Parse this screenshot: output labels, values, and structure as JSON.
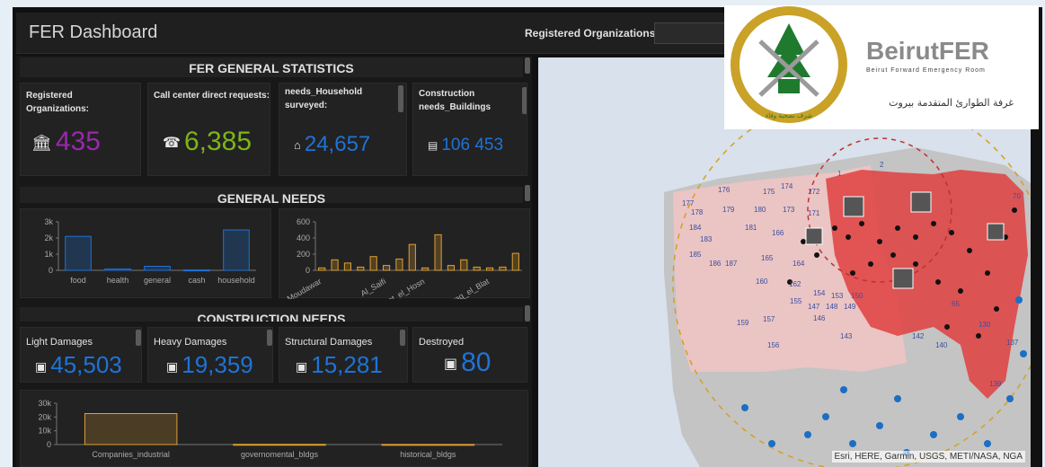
{
  "header": {
    "title": "FER Dashboard",
    "registered_label": "Registered Organizations:"
  },
  "sections": {
    "general_statistics": "FER GENERAL STATISTICS",
    "general_needs": "GENERAL NEEDS",
    "construction_needs": "CONSTRUCTION NEEDS"
  },
  "stats": [
    {
      "label": "Registered Organizations:",
      "value": "435",
      "icon": "institution-icon",
      "color": "#9b27b0"
    },
    {
      "label": "Call center direct requests:",
      "value": "6,385",
      "icon": "phone-icon",
      "color": "#7cb518"
    },
    {
      "label": "needs_Household surveyed:",
      "value": "24,657",
      "icon": "home-icon",
      "color": "#1e73d8"
    },
    {
      "label": "Construction needs_Buildings",
      "value": "106 453",
      "icon": "building-icon",
      "color": "#1e73d8"
    }
  ],
  "construction": [
    {
      "label": "Light Damages",
      "value": "45,503",
      "icon": "bookmark-icon",
      "color": "#1e73d8"
    },
    {
      "label": "Heavy Damages",
      "value": "19,359",
      "icon": "bookmark-icon",
      "color": "#1e73d8"
    },
    {
      "label": "Structural Damages",
      "value": "15,281",
      "icon": "bookmark-icon",
      "color": "#1e73d8"
    },
    {
      "label": "Destroyed",
      "value": "80",
      "icon": "bookmark-icon",
      "color": "#1e73d8"
    }
  ],
  "chart_data": [
    {
      "type": "bar",
      "categories": [
        "food",
        "health",
        "general",
        "cash",
        "household"
      ],
      "values": [
        2100,
        80,
        250,
        20,
        2500
      ],
      "yticks": [
        "3k",
        "2k",
        "1k",
        "0"
      ],
      "ylim": [
        0,
        3000
      ],
      "color": "#1e73d8"
    },
    {
      "type": "bar",
      "categories": [
        "_Moudawar",
        "",
        "",
        "",
        "",
        "Al_Saifi",
        "",
        "",
        "Minet_el_Hosn",
        "",
        "",
        "",
        "",
        "Zoqaq_el_Blat",
        "",
        ""
      ],
      "values": [
        30,
        130,
        90,
        40,
        170,
        60,
        140,
        320,
        30,
        440,
        60,
        130,
        40,
        30,
        40,
        210
      ],
      "yticks": [
        "600",
        "400",
        "200",
        "0"
      ],
      "ylim": [
        0,
        600
      ],
      "color": "#e0a030"
    },
    {
      "type": "bar",
      "categories": [
        "Companies_industrial",
        "governomental_bldgs",
        "historical_bldgs"
      ],
      "values": [
        22500,
        150,
        100
      ],
      "yticks": [
        "30k",
        "20k",
        "10k",
        "0"
      ],
      "ylim": [
        0,
        30000
      ],
      "color": "#e0a030"
    }
  ],
  "map": {
    "credit": "Esri, HERE, Garmin, USGS, METI/NASA, NGA",
    "zone_labels": [
      "176",
      "175",
      "174",
      "172",
      "177",
      "178",
      "179",
      "180",
      "173",
      "171",
      "184",
      "181",
      "166",
      "183",
      "185",
      "186",
      "187",
      "165",
      "164",
      "160",
      "162",
      "155",
      "154",
      "153",
      "150",
      "159",
      "157",
      "146",
      "147",
      "148",
      "149",
      "156",
      "143",
      "142",
      "140",
      "137",
      "130",
      "139",
      "2",
      "1",
      "70",
      "65"
    ]
  },
  "logo": {
    "brand": "BeirutFER",
    "tagline": "Beirut Forward Emergency Room",
    "arabic": "غرفة الطوارئ المتقدمة بيروت",
    "seal_text": "شرف تضحية وفاء"
  }
}
